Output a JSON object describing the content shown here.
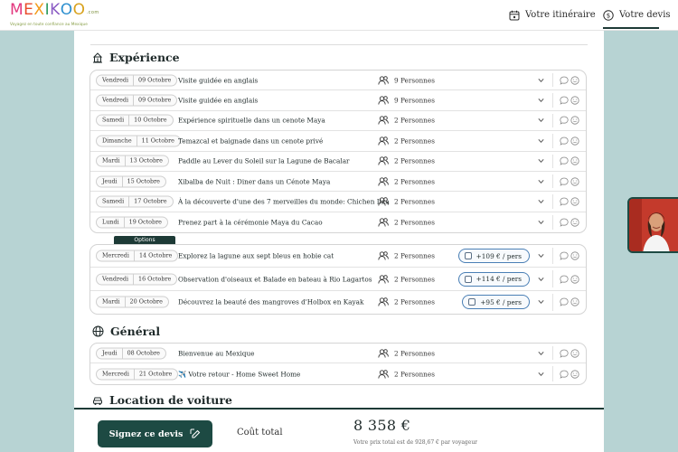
{
  "brand": {
    "logo_letters": [
      "M",
      "E",
      "X",
      "I",
      "K",
      "O",
      "O"
    ],
    "logo_colors": [
      "#e2377e",
      "#e84b2a",
      "#f39c1d",
      "#2e9c5e",
      "#8a5bc4",
      "#2c8fcf",
      "#d8a21d"
    ],
    "logo_tm": ".com",
    "tagline": "Voyagez en toute confiance au Mexique"
  },
  "nav": {
    "itinerary_label": "Votre itinéraire",
    "quote_label": "Votre devis"
  },
  "sections": {
    "experience_title": "Expérience",
    "general_title": "Général",
    "car_title": "Location de voiture",
    "options_label": "Options"
  },
  "experience_rows": [
    {
      "day": "Vendredi",
      "date": "09 Octobre",
      "title": "Visite guidée en anglais",
      "people": "9 Personnes"
    },
    {
      "day": "Vendredi",
      "date": "09 Octobre",
      "title": "Visite guidée en anglais",
      "people": "9 Personnes"
    },
    {
      "day": "Samedi",
      "date": "10 Octobre",
      "title": "Expérience spirituelle dans un cenote Maya",
      "people": "2 Personnes"
    },
    {
      "day": "Dimanche",
      "date": "11 Octobre",
      "title": "Temazcal et baignade dans un cenote privé",
      "people": "2 Personnes"
    },
    {
      "day": "Mardi",
      "date": "13 Octobre",
      "title": "Paddle au Lever du Soleil sur la Lagune de Bacalar",
      "people": "2 Personnes"
    },
    {
      "day": "Jeudi",
      "date": "15 Octobre",
      "title": "Xibalba de Nuit : Diner dans un Cénote Maya",
      "people": "2 Personnes"
    },
    {
      "day": "Samedi",
      "date": "17 Octobre",
      "title": "À la découverte d'une des 7 merveilles du monde: Chichen Itza",
      "people": "2 Personnes"
    },
    {
      "day": "Lundi",
      "date": "19 Octobre",
      "title": "Prenez part à la cérémonie Maya du Cacao",
      "people": "2 Personnes"
    }
  ],
  "option_rows": [
    {
      "day": "Mercredi",
      "date": "14 Octobre",
      "title": "Explorez la lagune aux sept bleus en hobie cat",
      "people": "2 Personnes",
      "price": "+109 € / pers"
    },
    {
      "day": "Vendredi",
      "date": "16 Octobre",
      "title": "Observation d'oiseaux et Balade en bateau à Rio Lagartos",
      "people": "2 Personnes",
      "price": "+114 € / pers"
    },
    {
      "day": "Mardi",
      "date": "20 Octobre",
      "title": "Découvrez la beauté des mangroves d'Holbox en Kayak",
      "people": "2 Personnes",
      "price": "+95 € / pers"
    }
  ],
  "general_rows": [
    {
      "day": "Jeudi",
      "date": "08 Octobre",
      "title": "Bienvenue au Mexique",
      "people": "2 Personnes"
    },
    {
      "day": "Mercredi",
      "date": "21 Octobre",
      "title": "✈️ Votre retour - Home Sweet Home",
      "people": "2 Personnes"
    }
  ],
  "footer": {
    "sign_label": "Signez ce devis",
    "cost_label": "Coût total",
    "total": "8 358 €",
    "note": "Votre prix total est de 928,67 € par voyageur"
  },
  "icons": {
    "itinerary": "calendar-icon",
    "quote": "euro-coin-icon",
    "experience": "temple-icon",
    "general": "globe-icon",
    "car": "car-icon",
    "people": "users-icon",
    "chevron": "chevron-down-icon",
    "comment": "comment-icon",
    "smiley": "smiley-icon",
    "sign": "signature-icon"
  },
  "colors": {
    "accent": "#1d4a43",
    "background": "#b7d3d3",
    "price_border": "#4a7fb5"
  }
}
